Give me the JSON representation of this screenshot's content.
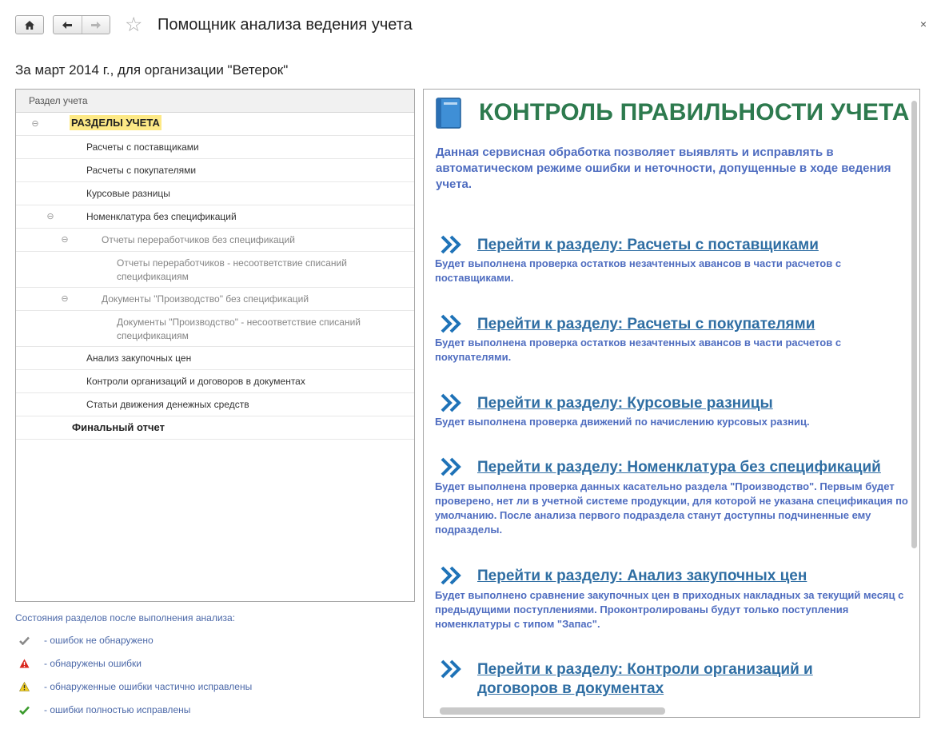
{
  "window": {
    "title": "Помощник анализа ведения учета",
    "close": "×"
  },
  "subtitle": "За март 2014 г., для организации \"Ветерок\"",
  "tree": {
    "header": "Раздел учета",
    "items": [
      {
        "label": "РАЗДЕЛЫ УЧЕТА"
      },
      {
        "label": "Расчеты с поставщиками"
      },
      {
        "label": "Расчеты с покупателями"
      },
      {
        "label": "Курсовые разницы"
      },
      {
        "label": "Номенклатура без спецификаций"
      },
      {
        "label": "Отчеты переработчиков без спецификаций"
      },
      {
        "label": "Отчеты переработчиков - несоответствие списаний спецификациям"
      },
      {
        "label": "Документы \"Производство\" без спецификаций"
      },
      {
        "label": "Документы \"Производство\" - несоответствие списаний спецификациям"
      },
      {
        "label": "Анализ закупочных цен"
      },
      {
        "label": "Контроли организаций и договоров в документах"
      },
      {
        "label": "Статьи движения денежных средств"
      },
      {
        "label": "Финальный отчет"
      }
    ]
  },
  "legend": {
    "title": "Состояния разделов после выполнения анализа:",
    "items": [
      {
        "label": "- ошибок не обнаружено",
        "icon": "check-grey-icon",
        "color": "#8a8a8a"
      },
      {
        "label": "- обнаружены ошибки",
        "icon": "warning-red-icon",
        "color": "#d9261c"
      },
      {
        "label": "- обнаруженные ошибки частично исправлены",
        "icon": "warning-yellow-icon",
        "color": "#f2cf1f"
      },
      {
        "label": "- ошибки полностью исправлены",
        "icon": "check-green-icon",
        "color": "#3a9b2c"
      }
    ]
  },
  "panel": {
    "title": "КОНТРОЛЬ ПРАВИЛЬНОСТИ УЧЕТА",
    "intro": "Данная сервисная обработка позволяет выявлять и исправлять в автоматическом режиме ошибки и неточности, допущенные в ходе ведения учета.",
    "sections": [
      {
        "link": "Перейти к разделу: Расчеты с поставщиками",
        "desc": "Будет выполнена проверка остатков незачтенных авансов в части расчетов с поставщиками."
      },
      {
        "link": "Перейти к разделу: Расчеты с покупателями",
        "desc": "Будет выполнена проверка остатков незачтенных авансов в части расчетов с покупателями."
      },
      {
        "link": "Перейти к разделу: Курсовые разницы",
        "desc": "Будет выполнена проверка движений по начислению курсовых разниц."
      },
      {
        "link": "Перейти к разделу: Номенклатура без спецификаций",
        "desc": "Будет выполнена проверка данных касательно раздела \"Производство\". Первым будет проверено, нет ли в учетной системе продукции, для которой не указана спецификация по умолчанию. После анализа первого подраздела станут доступны подчиненные ему подразделы."
      },
      {
        "link": "Перейти к разделу: Анализ закупочных цен",
        "desc": "Будет выполнено сравнение закупочных цен в приходных накладных за текущий месяц с предыдущими поступлениями. Проконтролированы будут только поступления номенклатуры с типом \"Запас\"."
      },
      {
        "link": "Перейти к разделу: Контроли организаций и договоров в документах",
        "desc": ""
      }
    ],
    "colors": {
      "title": "#2d7a4e",
      "text": "#4f6dc0",
      "link": "#2f6ea3",
      "arrow": "#1f73b8"
    }
  }
}
